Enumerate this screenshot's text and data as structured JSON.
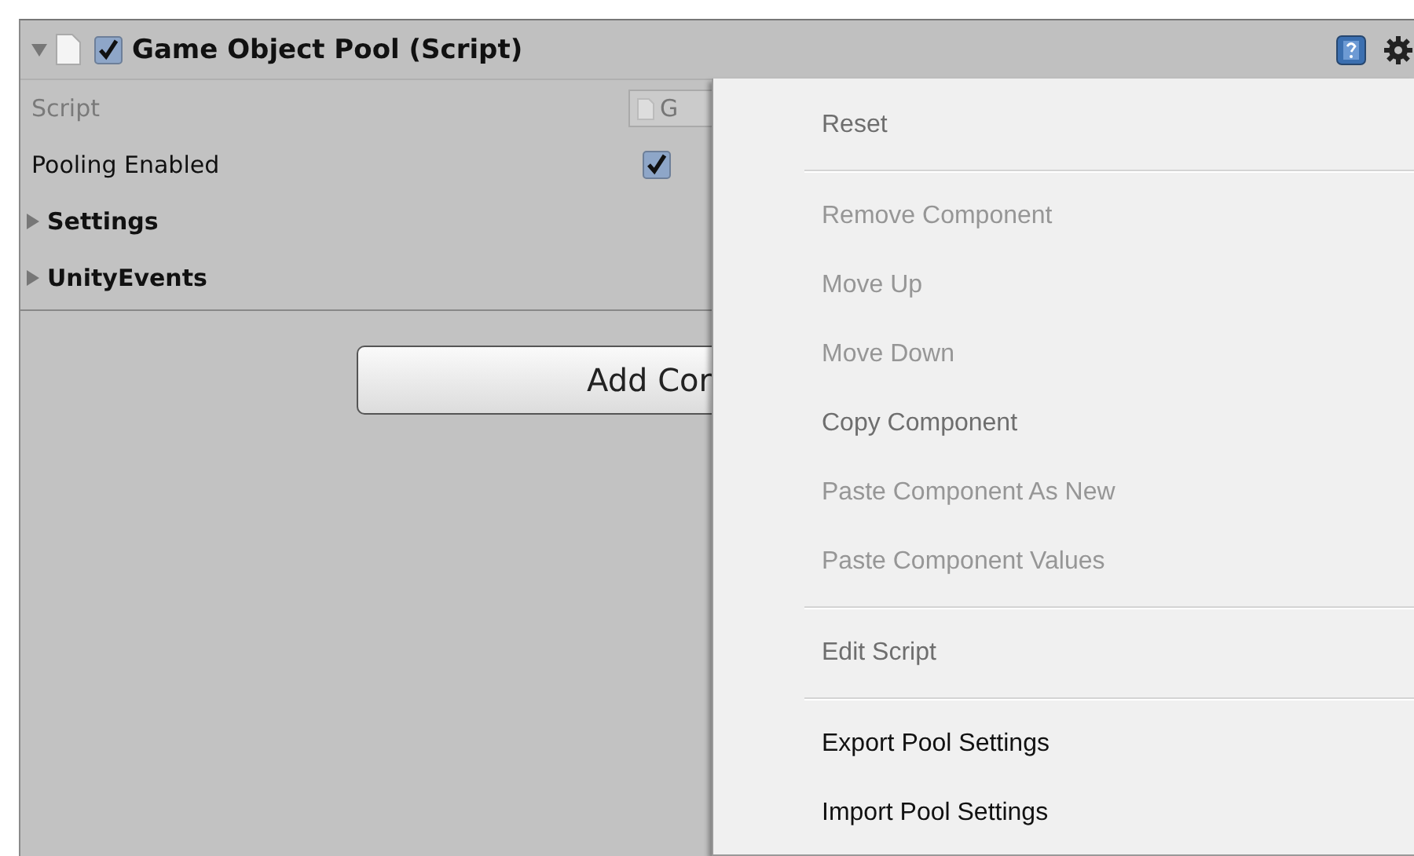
{
  "component": {
    "title": "Game Object Pool (Script)",
    "expanded": true,
    "enabled": true
  },
  "properties": [
    {
      "kind": "object",
      "label": "Script",
      "value": "G",
      "disabled": true
    },
    {
      "kind": "toggle",
      "label": "Pooling Enabled",
      "checked": true
    },
    {
      "kind": "foldout",
      "label": "Settings",
      "expanded": false
    },
    {
      "kind": "foldout",
      "label": "UnityEvents",
      "expanded": false
    }
  ],
  "add_button": "Add Cor",
  "context_menu": [
    {
      "kind": "item",
      "label": "Reset",
      "faded": true,
      "disabled": false
    },
    {
      "kind": "separator"
    },
    {
      "kind": "item",
      "label": "Remove Component",
      "faded": true,
      "disabled": true
    },
    {
      "kind": "item",
      "label": "Move Up",
      "faded": true,
      "disabled": true
    },
    {
      "kind": "item",
      "label": "Move Down",
      "faded": true,
      "disabled": true
    },
    {
      "kind": "item",
      "label": "Copy Component",
      "faded": true,
      "disabled": false
    },
    {
      "kind": "item",
      "label": "Paste Component As New",
      "faded": true,
      "disabled": true
    },
    {
      "kind": "item",
      "label": "Paste Component Values",
      "faded": true,
      "disabled": true
    },
    {
      "kind": "separator"
    },
    {
      "kind": "item",
      "label": "Edit Script",
      "faded": true,
      "disabled": false
    },
    {
      "kind": "separator"
    },
    {
      "kind": "item",
      "label": "Export Pool Settings",
      "faded": false,
      "disabled": false
    },
    {
      "kind": "item",
      "label": "Import Pool Settings",
      "faded": false,
      "disabled": false
    }
  ]
}
